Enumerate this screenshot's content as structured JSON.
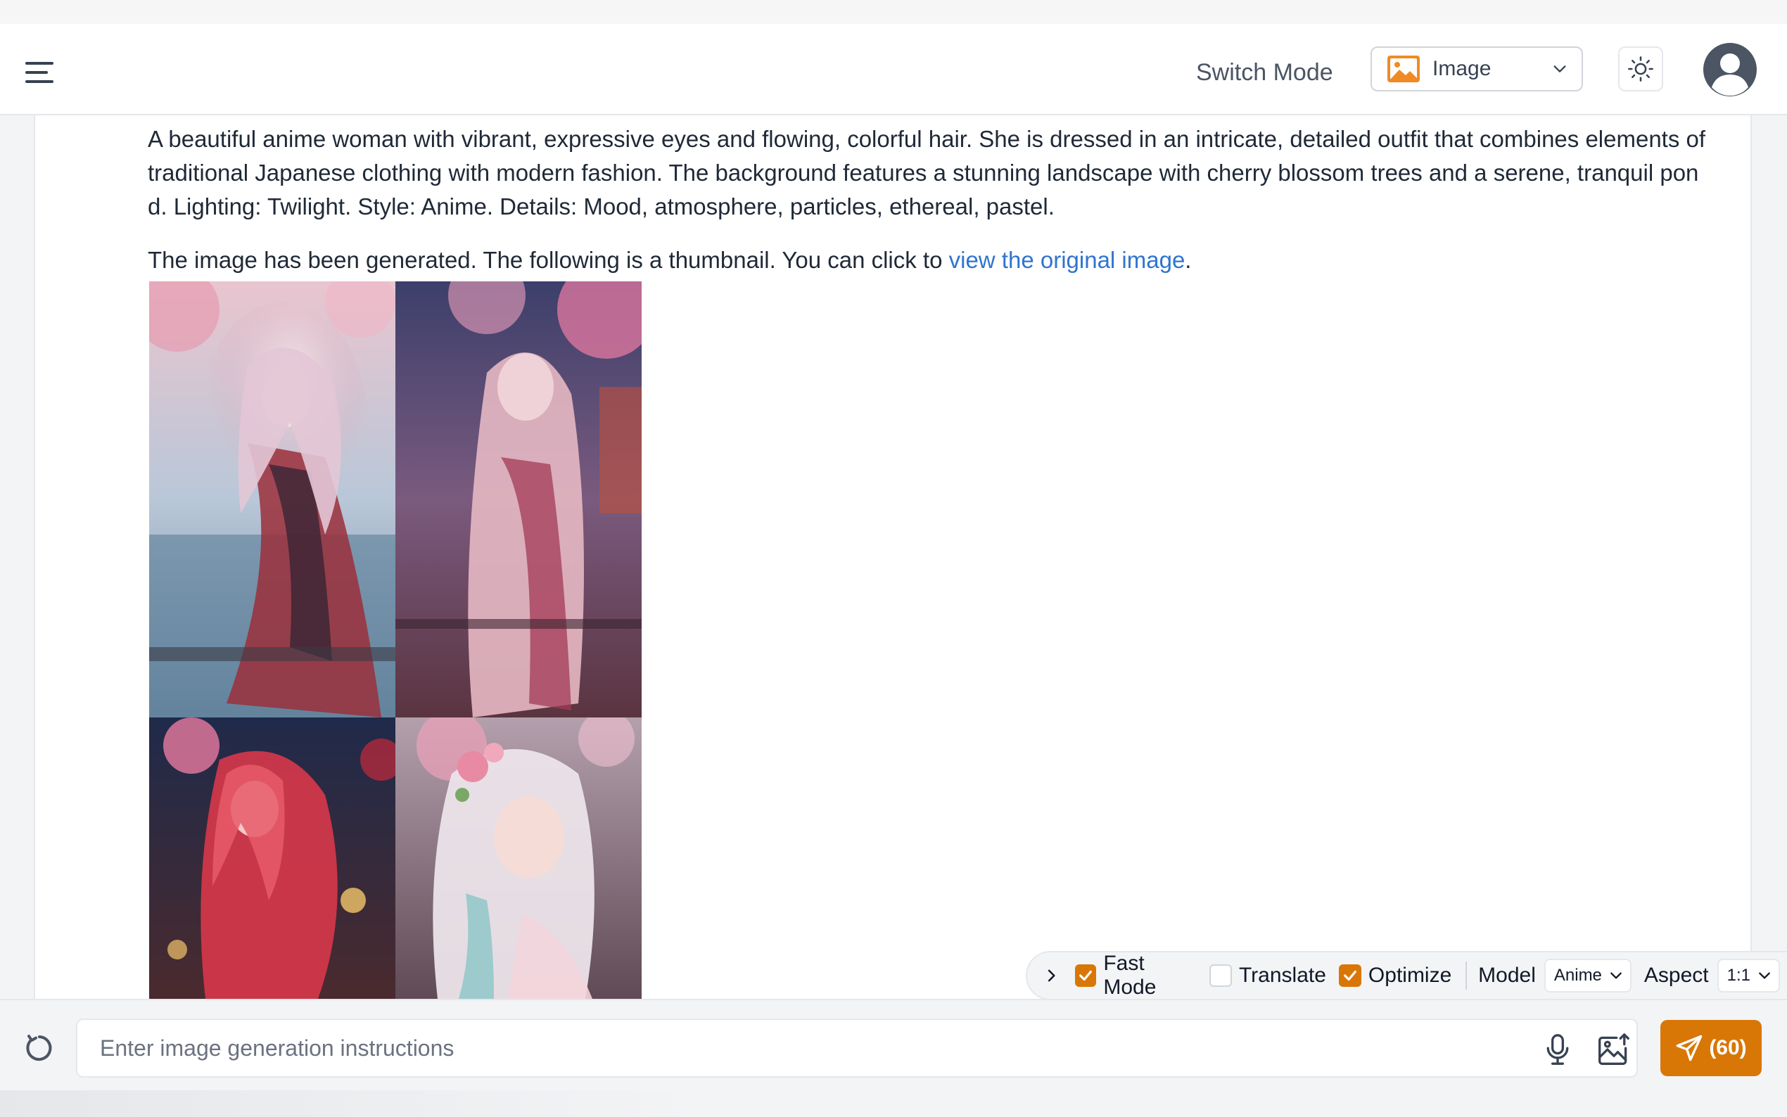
{
  "header": {
    "switch_mode_label": "Switch Mode",
    "mode_value": "Image"
  },
  "message": {
    "prompt": "A beautiful anime woman with vibrant, expressive eyes and flowing, colorful hair. She is dressed in an intricate, detailed outfit that combines elements of traditional Japanese clothing with modern fashion. The background features a stunning landscape with cherry blossom trees and a serene, tranquil pond. Lighting: Twilight. Style: Anime. Details: Mood, atmosphere, particles, ethereal, pastel.",
    "generated_prefix": "The image has been generated. The following is a thumbnail. You can click to ",
    "generated_link": "view the original image",
    "generated_suffix": "."
  },
  "options": {
    "fast_mode": {
      "label": "Fast Mode",
      "checked": true
    },
    "translate": {
      "label": "Translate",
      "checked": false
    },
    "optimize": {
      "label": "Optimize",
      "checked": true
    },
    "model_label": "Model",
    "model_value": "Anime",
    "aspect_label": "Aspect",
    "aspect_value": "1:1"
  },
  "composer": {
    "placeholder": "Enter image generation instructions",
    "send_label": "(60)"
  },
  "colors": {
    "accent": "#d97706",
    "link": "#2f74d0"
  },
  "icons": [
    "menu-icon",
    "image-icon",
    "chevron-down-icon",
    "sun-icon",
    "user-avatar-icon",
    "chevron-right-icon",
    "check-icon",
    "refresh-icon",
    "microphone-icon",
    "image-upload-icon",
    "send-icon"
  ]
}
